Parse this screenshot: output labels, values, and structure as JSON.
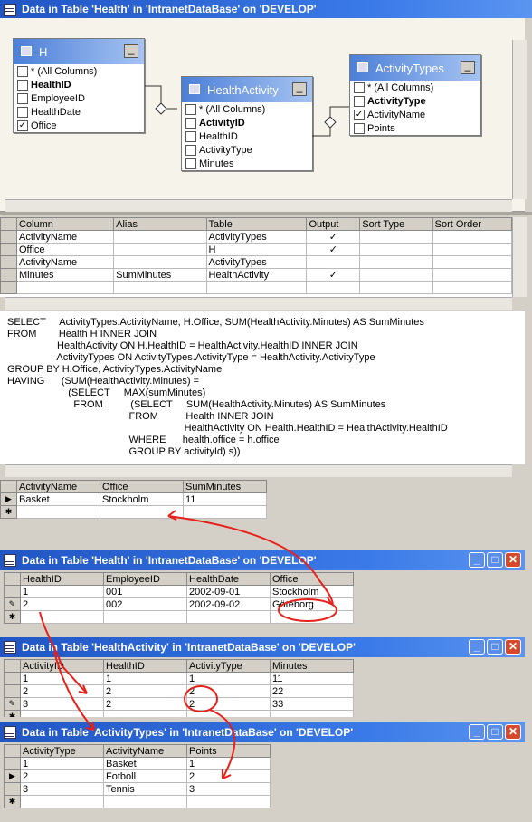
{
  "top_window": {
    "title": "Data in Table 'Health' in 'IntranetDataBase' on 'DEVELOP'"
  },
  "diagram": {
    "tables": [
      {
        "name": "H",
        "columns": [
          {
            "label": "* (All Columns)",
            "checked": false,
            "bold": false
          },
          {
            "label": "HealthID",
            "checked": false,
            "bold": true
          },
          {
            "label": "EmployeeID",
            "checked": false,
            "bold": false
          },
          {
            "label": "HealthDate",
            "checked": false,
            "bold": false
          },
          {
            "label": "Office",
            "checked": true,
            "bold": false
          }
        ]
      },
      {
        "name": "HealthActivity",
        "columns": [
          {
            "label": "* (All Columns)",
            "checked": false,
            "bold": false
          },
          {
            "label": "ActivityID",
            "checked": false,
            "bold": true
          },
          {
            "label": "HealthID",
            "checked": false,
            "bold": false
          },
          {
            "label": "ActivityType",
            "checked": false,
            "bold": false
          },
          {
            "label": "Minutes",
            "checked": false,
            "bold": false
          }
        ]
      },
      {
        "name": "ActivityTypes",
        "columns": [
          {
            "label": "* (All Columns)",
            "checked": false,
            "bold": false
          },
          {
            "label": "ActivityType",
            "checked": false,
            "bold": true
          },
          {
            "label": "ActivityName",
            "checked": true,
            "bold": false
          },
          {
            "label": "Points",
            "checked": false,
            "bold": false
          }
        ]
      }
    ]
  },
  "criteria": {
    "headers": [
      "Column",
      "Alias",
      "Table",
      "Output",
      "Sort Type",
      "Sort Order"
    ],
    "rows": [
      [
        "ActivityName",
        "",
        "ActivityTypes",
        "✓",
        "",
        ""
      ],
      [
        "Office",
        "",
        "H",
        "✓",
        "",
        ""
      ],
      [
        "ActivityName",
        "",
        "ActivityTypes",
        "",
        "",
        ""
      ],
      [
        "Minutes",
        "SumMinutes",
        "HealthActivity",
        "✓",
        "",
        ""
      ]
    ]
  },
  "sql": {
    "lines": [
      "SELECT     ActivityTypes.ActivityName, H.Office, SUM(HealthActivity.Minutes) AS SumMinutes",
      "FROM        Health H INNER JOIN",
      "                  HealthActivity ON H.HealthID = HealthActivity.HealthID INNER JOIN",
      "                  ActivityTypes ON ActivityTypes.ActivityType = HealthActivity.ActivityType",
      "GROUP BY H.Office, ActivityTypes.ActivityName",
      "HAVING      (SUM(HealthActivity.Minutes) =",
      "                      (SELECT     MAX(sumMinutes)",
      "                        FROM          (SELECT     SUM(HealthActivity.Minutes) AS SumMinutes",
      "                                            FROM          Health INNER JOIN",
      "                                                                HealthActivity ON Health.HealthID = HealthActivity.HealthID",
      "                                            WHERE      health.office = h.office",
      "                                            GROUP BY activityId) s))"
    ]
  },
  "results": {
    "headers": [
      "ActivityName",
      "Office",
      "SumMinutes"
    ],
    "rows": [
      [
        "Basket",
        "Stockholm",
        "11"
      ]
    ]
  },
  "windows": [
    {
      "title": "Data in Table 'Health' in 'IntranetDataBase' on 'DEVELOP'",
      "headers": [
        "HealthID",
        "EmployeeID",
        "HealthDate",
        "Office"
      ],
      "rows": [
        [
          "1",
          "001",
          "2002-09-01",
          "Stockholm"
        ],
        [
          "2",
          "002",
          "2002-09-02",
          "Göteborg"
        ]
      ]
    },
    {
      "title": "Data in Table 'HealthActivity' in 'IntranetDataBase' on 'DEVELOP'",
      "headers": [
        "ActivityID",
        "HealthID",
        "ActivityType",
        "Minutes"
      ],
      "rows": [
        [
          "1",
          "1",
          "1",
          "11"
        ],
        [
          "2",
          "2",
          "2",
          "22"
        ],
        [
          "3",
          "2",
          "2",
          "33"
        ]
      ]
    },
    {
      "title": "Data in Table 'ActivityTypes' in 'IntranetDataBase' on 'DEVELOP'",
      "headers": [
        "ActivityType",
        "ActivityName",
        "Points"
      ],
      "rows": [
        [
          "1",
          "Basket",
          "1"
        ],
        [
          "2",
          "Fotboll",
          "2"
        ],
        [
          "3",
          "Tennis",
          "3"
        ]
      ]
    }
  ],
  "glyphs": {
    "minimize": "_",
    "maximize": "□",
    "close": "✕",
    "current_row": "▶",
    "new_row": "✱",
    "editing_row": "✎",
    "collapse": "▬"
  },
  "colors": {
    "titlebar": "#2155c4",
    "annotation": "#e8201a",
    "close_button": "#d8492b"
  }
}
